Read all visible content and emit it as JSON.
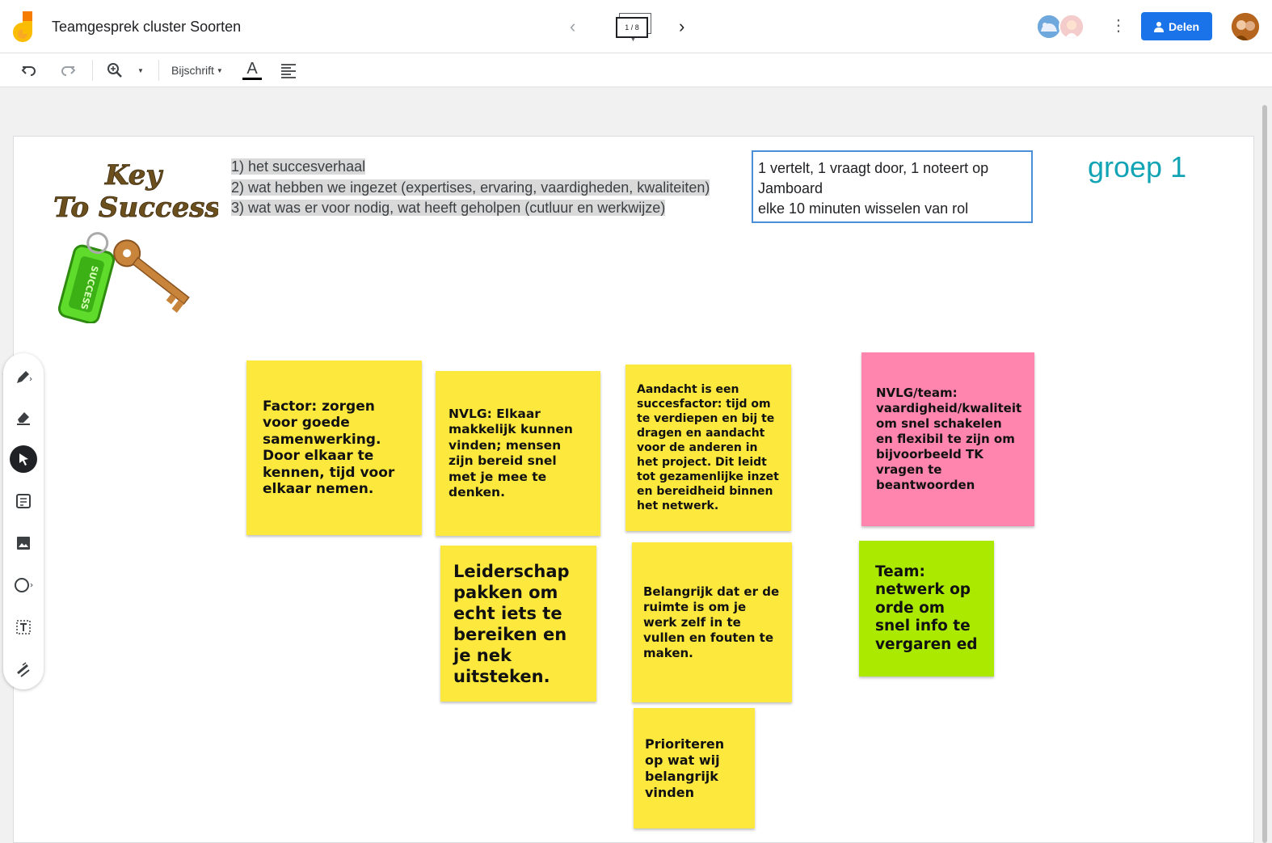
{
  "app": {
    "title": "Teamgesprek cluster Soorten",
    "frame_indicator": "1 / 8",
    "share_label": "Delen"
  },
  "toolbar": {
    "style_label": "Bijschrift",
    "text_color_glyph": "A"
  },
  "board": {
    "instructions": [
      "1) het succesverhaal",
      "2) wat hebben we ingezet (expertises, ervaring, vaardigheden, kwaliteiten)",
      "3) wat was er voor nodig, wat heeft geholpen (cutluur en werkwijze)"
    ],
    "rolebox_lines": [
      "1 vertelt, 1 vraagt door, 1 noteert op",
      "Jamboard",
      "elke 10 minuten wisselen van rol"
    ],
    "group_label": "groep 1",
    "image_text": [
      "Key",
      "To Success",
      "SUCCESS"
    ]
  },
  "sticky_notes": [
    {
      "id": "s1",
      "color": "yellow",
      "text": "Factor: zorgen voor goede samenwerking. Door elkaar te kennen, tijd voor elkaar nemen."
    },
    {
      "id": "s2",
      "color": "yellow",
      "text": "NVLG: Elkaar makkelijk kunnen vinden; mensen zijn bereid snel met je mee te denken."
    },
    {
      "id": "s3",
      "color": "yellow",
      "text": "Aandacht is een succesfactor: tijd om te verdiepen en  bij te dragen en aandacht voor de anderen in het project. Dit leidt tot gezamenlijke inzet en bereidheid binnen het netwerk."
    },
    {
      "id": "s4",
      "color": "pink",
      "text": "NVLG/team: vaardigheid/kwaliteit om snel schakelen en flexibil te zijn om bijvoorbeeld TK vragen te beantwoorden"
    },
    {
      "id": "s5",
      "color": "yellow",
      "text": "Leiderschap pakken om echt iets te bereiken en je nek uitsteken."
    },
    {
      "id": "s6",
      "color": "yellow",
      "text": "Belangrijk dat er de ruimte is om je werk zelf in te vullen en fouten te maken."
    },
    {
      "id": "s7",
      "color": "green",
      "text": "Team: netwerk op orde om snel info te vergaren ed"
    },
    {
      "id": "s8",
      "color": "yellow",
      "text": "Prioriteren op wat wij belangrijk vinden"
    }
  ],
  "colors": {
    "accent": "#1a73e8",
    "group_label": "#12a4b4",
    "sticky_yellow": "#fde93e",
    "sticky_pink": "#ff85ae",
    "sticky_green": "#abe900"
  }
}
